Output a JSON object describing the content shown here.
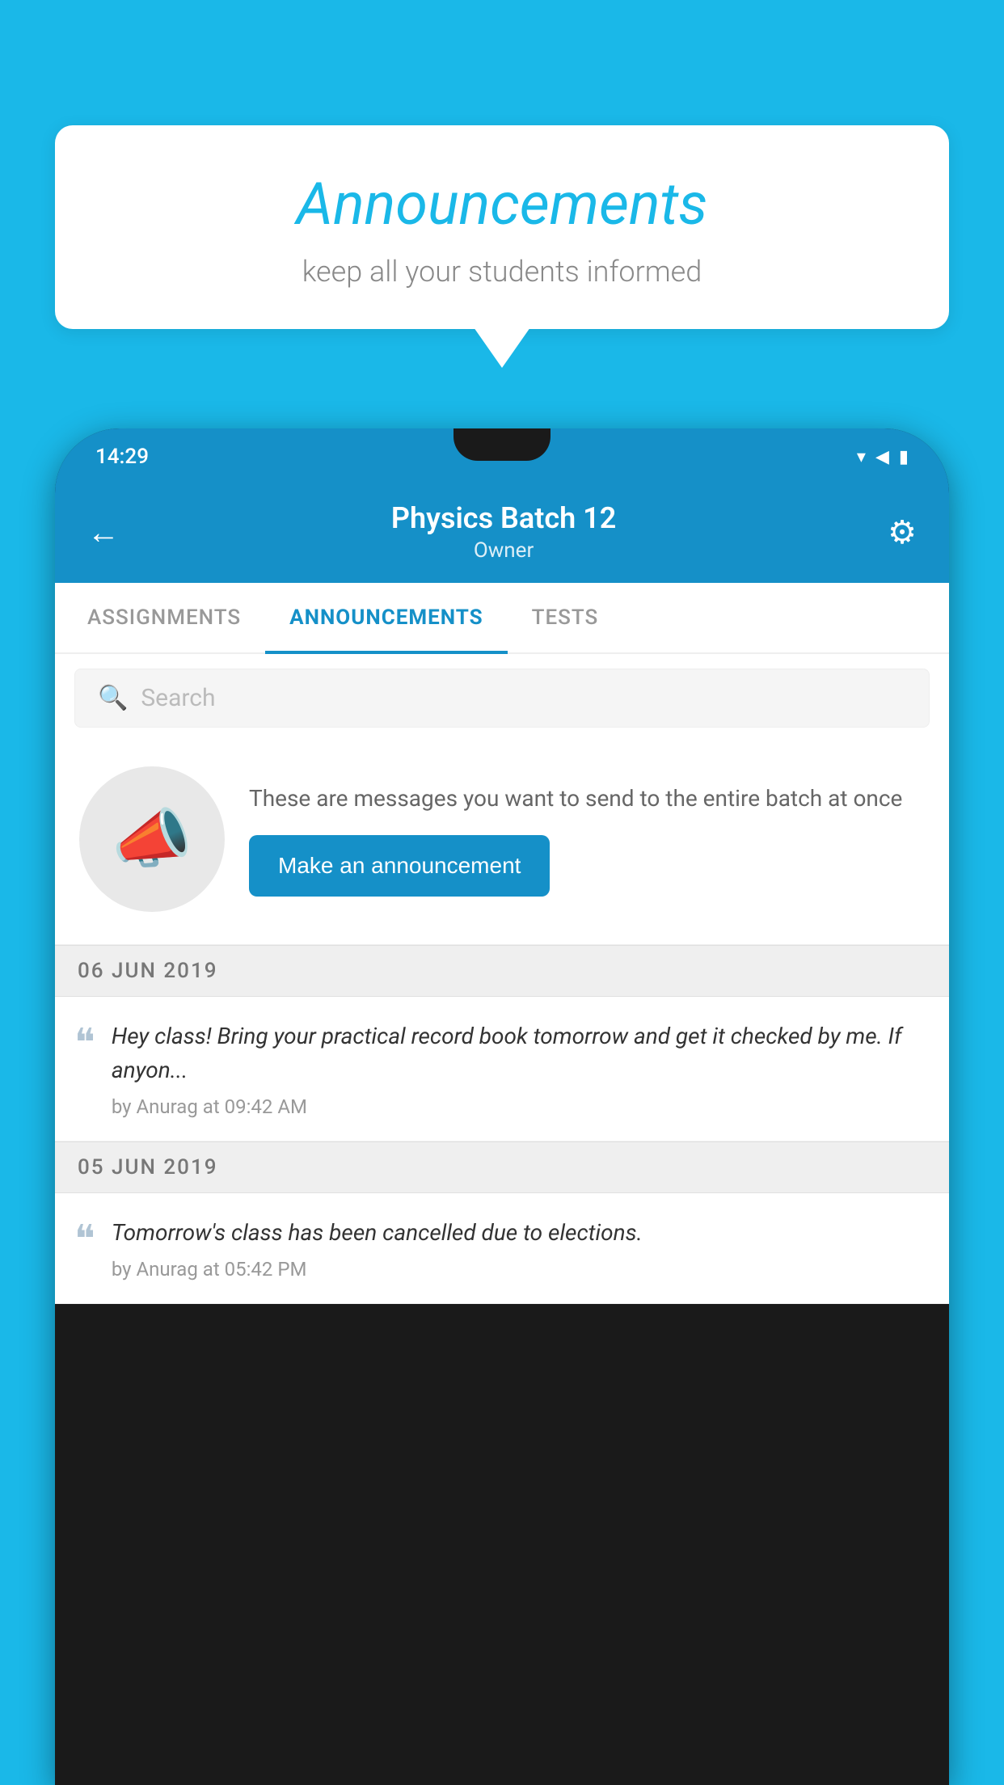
{
  "background_color": "#1ab8e8",
  "speech_bubble": {
    "title": "Announcements",
    "subtitle": "keep all your students informed"
  },
  "phone": {
    "status_bar": {
      "time": "14:29"
    },
    "header": {
      "back_label": "←",
      "title": "Physics Batch 12",
      "subtitle": "Owner",
      "gear_label": "⚙"
    },
    "tabs": [
      {
        "label": "ASSIGNMENTS",
        "active": false
      },
      {
        "label": "ANNOUNCEMENTS",
        "active": true
      },
      {
        "label": "TESTS",
        "active": false
      }
    ],
    "search": {
      "placeholder": "Search"
    },
    "promo": {
      "description": "These are messages you want to send to the entire batch at once",
      "button_label": "Make an announcement"
    },
    "date_sections": [
      {
        "date": "06  JUN  2019",
        "announcements": [
          {
            "text": "Hey class! Bring your practical record book tomorrow and get it checked by me. If anyon...",
            "meta": "by Anurag at 09:42 AM"
          }
        ]
      },
      {
        "date": "05  JUN  2019",
        "announcements": [
          {
            "text": "Tomorrow's class has been cancelled due to elections.",
            "meta": "by Anurag at 05:42 PM"
          }
        ]
      }
    ]
  }
}
